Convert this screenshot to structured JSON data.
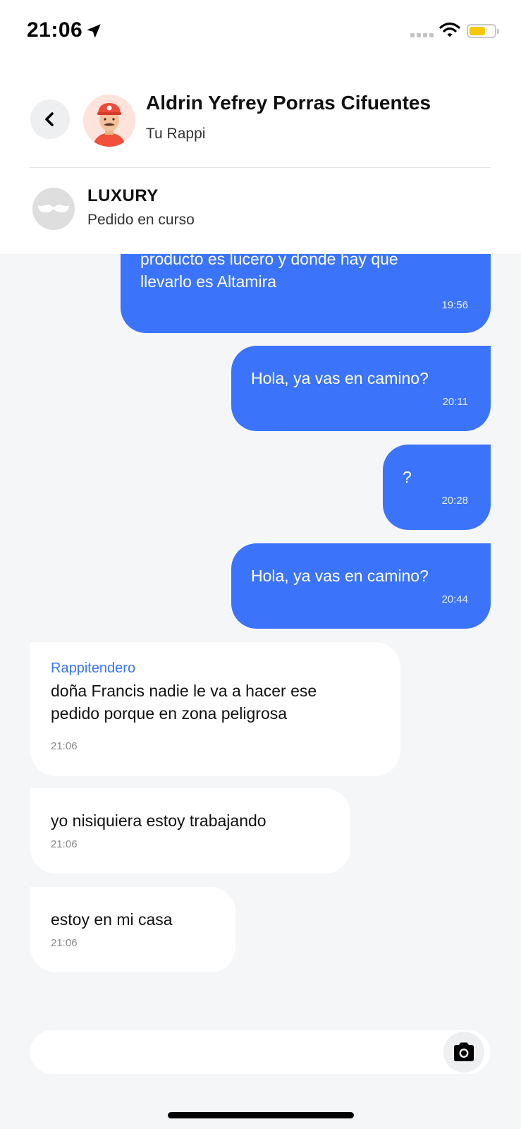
{
  "status_bar": {
    "time": "21:06",
    "battery_color": "#f6c800"
  },
  "header": {
    "contact_name": "Aldrin Yefrey Porras Cifuentes",
    "contact_subtitle": "Tu Rappi",
    "store_name": "LUXURY",
    "order_status": "Pedido en curso",
    "icons": {
      "back": "chevron-left-icon",
      "store_logo": "mustache-icon"
    }
  },
  "messages": [
    {
      "direction": "sent",
      "text_line1": "producto es lucero y donde hay que",
      "text_line2": "llevarlo es Altamira",
      "time": "19:56"
    },
    {
      "direction": "sent",
      "text": "Hola, ya vas en camino?",
      "time": "20:11"
    },
    {
      "direction": "sent",
      "text": "?",
      "time": "20:28"
    },
    {
      "direction": "sent",
      "text": "Hola, ya vas en camino?",
      "time": "20:44"
    },
    {
      "direction": "received",
      "sender": "Rappitendero",
      "text_line1": "doña Francis nadie le va a hacer ese",
      "text_line2": "pedido porque en zona peligrosa",
      "time": "21:06"
    },
    {
      "direction": "received",
      "text": "yo nisiquiera estoy trabajando",
      "time": "21:06"
    },
    {
      "direction": "received",
      "text": "estoy en mi casa",
      "time": "21:06"
    }
  ],
  "input": {
    "placeholder": "",
    "camera_icon": "camera-icon"
  },
  "colors": {
    "sent_bubble": "#3b74fa",
    "received_bubble": "#ffffff",
    "background": "#f5f6f8",
    "accent": "#3b74fa"
  }
}
